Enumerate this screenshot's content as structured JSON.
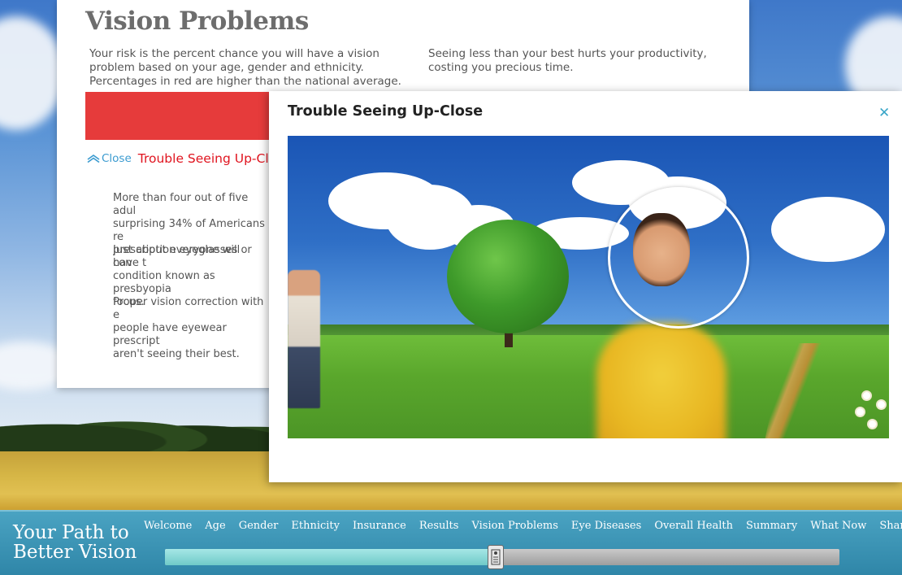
{
  "panel": {
    "title": "Vision Problems",
    "intro_left": "Your risk is the percent chance you will have a vision problem based on your age, gender and ethnicity. Percentages in red are higher than the national average.",
    "intro_right": "Seeing less than your best hurts your productivity, costing you precious time.",
    "close_label": "Close",
    "section_title": "Trouble Seeing Up-Close",
    "paragraphs": [
      "More than four out of five adul\nsurprising 34% of Americans re\nprescription eyeglasses or con",
      "Just about everyone will have t\ncondition known as presbyopia\nfocus.",
      "Proper vision correction with e\npeople have eyewear prescript\naren't seeing their best."
    ]
  },
  "modal": {
    "title": "Trouble Seeing Up-Close",
    "close_icon": "close-icon"
  },
  "nav": {
    "brand_line1": "Your Path to",
    "brand_line2": "Better Vision",
    "items": [
      "Welcome",
      "Age",
      "Gender",
      "Ethnicity",
      "Insurance",
      "Results",
      "Vision Problems",
      "Eye Diseases",
      "Overall Health",
      "Summary",
      "What Now",
      "Share"
    ],
    "active": "Vision Problems",
    "progress_fraction": 0.49
  },
  "colors": {
    "accent_red": "#e63b3b",
    "title_red": "#e0141f",
    "link_blue": "#3b9bd0",
    "nav_teal": "#3a95b6"
  }
}
